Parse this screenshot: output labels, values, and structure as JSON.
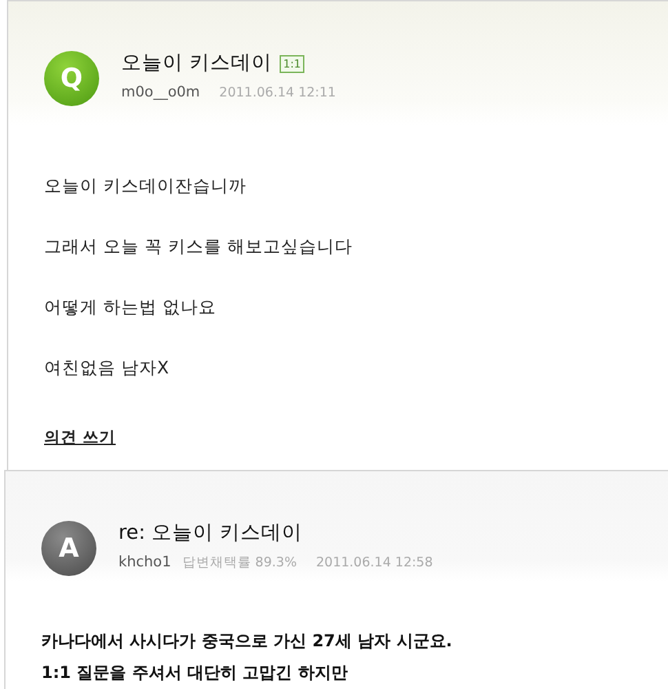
{
  "question": {
    "avatar": "Q",
    "title": "오늘이 키스데이",
    "badge": "1:1",
    "author": "m0o__o0m",
    "date": "2011.06.14 12:11",
    "body": [
      "오늘이 키스데이잔습니까",
      "그래서 오늘 꼭 키스를 해보고싶습니다",
      "어떻게 하는법 없나요",
      "여친없음 남자X"
    ],
    "comment_link": "의견 쓰기"
  },
  "answer": {
    "avatar": "A",
    "title": "re: 오늘이 키스데이",
    "author": "khcho1",
    "rate": "답변채택률 89.3%",
    "date": "2011.06.14 12:58",
    "body": [
      "카나다에서 사시다가 중국으로 가신 27세 남자 시군요.",
      "1:1 질문을 주셔서 대단히 고맙긴 하지만"
    ]
  }
}
